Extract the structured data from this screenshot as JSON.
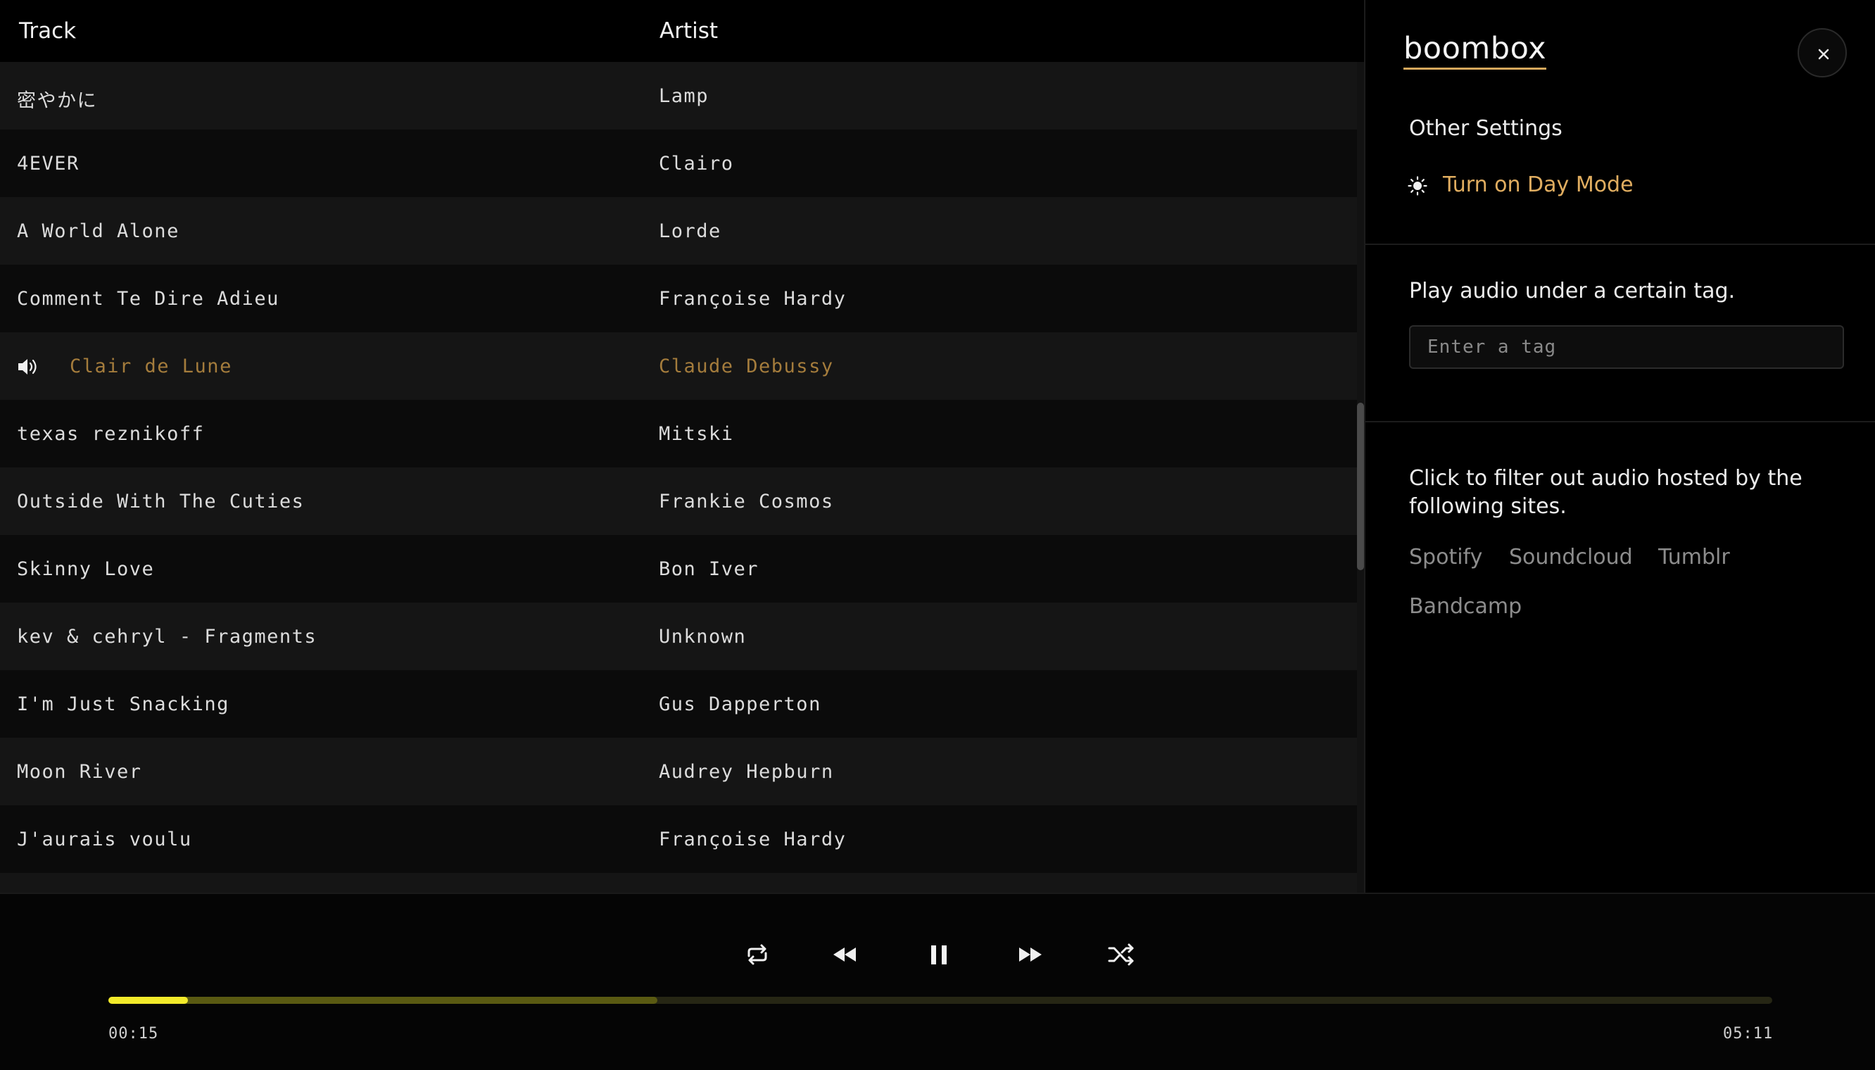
{
  "list": {
    "headers": {
      "track": "Track",
      "artist": "Artist"
    },
    "rows": [
      {
        "track": "密やかに",
        "artist": "Lamp"
      },
      {
        "track": "4EVER",
        "artist": "Clairo"
      },
      {
        "track": "A World Alone",
        "artist": "Lorde"
      },
      {
        "track": "Comment Te Dire Adieu",
        "artist": "Françoise Hardy"
      },
      {
        "track": "Clair de Lune",
        "artist": "Claude Debussy",
        "playing": true,
        "icon": "speaker-icon"
      },
      {
        "track": "texas reznikoff",
        "artist": "Mitski"
      },
      {
        "track": "Outside With The Cuties",
        "artist": "Frankie Cosmos"
      },
      {
        "track": "Skinny Love",
        "artist": "Bon Iver"
      },
      {
        "track": "kev & cehryl - Fragments",
        "artist": "Unknown"
      },
      {
        "track": "I'm Just Snacking",
        "artist": "Gus Dapperton"
      },
      {
        "track": "Moon River",
        "artist": "Audrey Hepburn"
      },
      {
        "track": "J'aurais voulu",
        "artist": "Françoise Hardy"
      },
      {
        "track": "",
        "artist": ""
      }
    ]
  },
  "panel": {
    "brand": "boombox",
    "close_icon": "close-icon",
    "other_settings": "Other Settings",
    "day_mode_label": "Turn on Day Mode",
    "day_mode_icon": "sun-icon",
    "tag_prompt": "Play audio under a certain tag.",
    "tag_placeholder": "Enter a tag",
    "tag_value": "",
    "filter_prompt": "Click to filter out audio hosted by the following sites.",
    "sites": [
      "Spotify",
      "Soundcloud",
      "Tumblr",
      "Bandcamp"
    ]
  },
  "player": {
    "controls": [
      "repeat-icon",
      "rewind-icon",
      "pause-icon",
      "fast-forward-icon",
      "shuffle-icon"
    ],
    "current_time": "00:15",
    "total_time": "05:11",
    "progress_fraction": 0.048,
    "buffered_fraction": 0.33
  },
  "colors": {
    "background": "#000000",
    "accent": "#e0ad60",
    "playing_text": "#a47c3c",
    "progress": "#f2ea2a",
    "buffer": "#5a5a12"
  }
}
